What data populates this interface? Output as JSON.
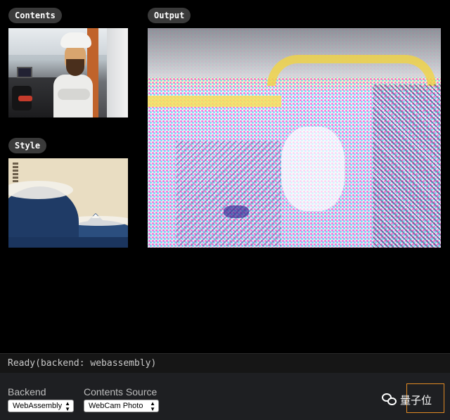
{
  "labels": {
    "contents": "Contents",
    "style": "Style",
    "output": "Output"
  },
  "status": {
    "text": "Ready(backend: webassembly)"
  },
  "controls": {
    "backend_label": "Backend",
    "backend_value": "WebAssembly",
    "source_label": "Contents Source",
    "source_value": "WebCam Photo"
  },
  "watermark": {
    "text": "量子位",
    "icon": "wechat-icon"
  },
  "colors": {
    "background": "#000000",
    "pill": "#3a3a3a",
    "controls_bar": "#1e1f22",
    "accent_box": "#e08a24"
  }
}
